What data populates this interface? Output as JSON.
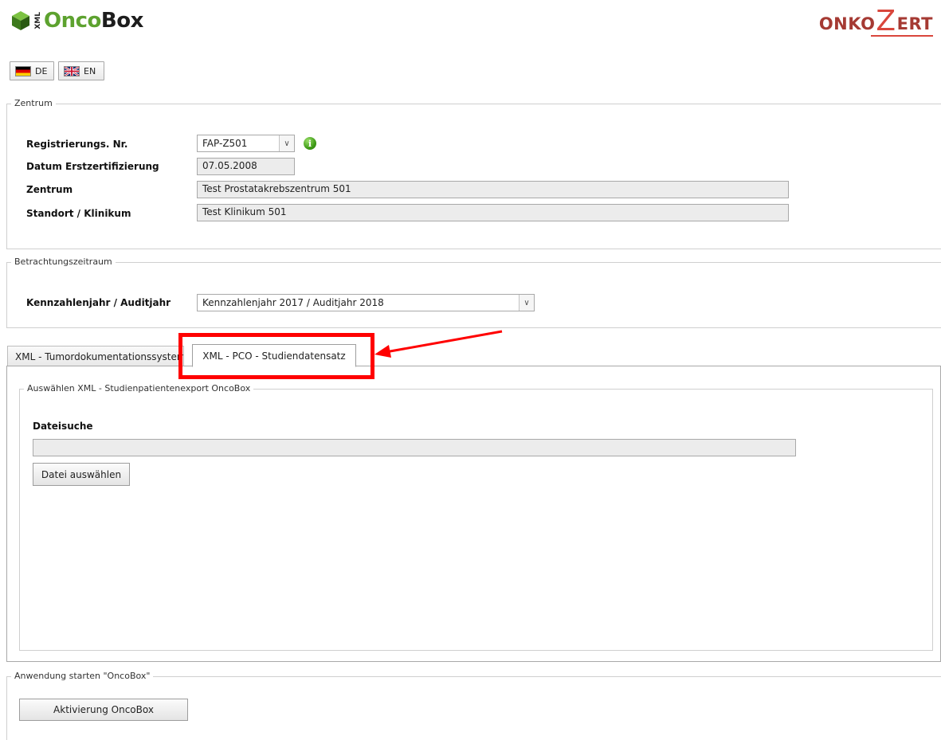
{
  "header": {
    "logo_xml": "XML",
    "logo_onco": "Onco",
    "logo_box": "Box",
    "partner_onko": "ONKO",
    "partner_z": "Z",
    "partner_ert": "ERT"
  },
  "language": {
    "de_label": "DE",
    "en_label": "EN"
  },
  "zentrum": {
    "legend": "Zentrum",
    "reg_label": "Registrierungs. Nr.",
    "reg_value": "FAP-Z501",
    "datum_label": "Datum Erstzertifizierung",
    "datum_value": "07.05.2008",
    "zentrum_label": "Zentrum",
    "zentrum_value": "Test Prostatakrebszentrum 501",
    "standort_label": "Standort / Klinikum",
    "standort_value": "Test Klinikum 501"
  },
  "betrachtung": {
    "legend": "Betrachtungszeitraum",
    "kennzahl_label": "Kennzahlenjahr / Auditjahr",
    "kennzahl_value": "Kennzahlenjahr 2017 / Auditjahr 2018"
  },
  "tabs": [
    {
      "label": "XML - Tumordokumentationssystem",
      "active": false
    },
    {
      "label": "XML - PCO - Studiendatensatz",
      "active": true
    }
  ],
  "panel": {
    "legend": "Auswählen XML - Studienpatientenexport OncoBox",
    "dateisuche_label": "Dateisuche",
    "file_value": "",
    "choose_button": "Datei auswählen"
  },
  "launch": {
    "legend": "Anwendung starten \"OncoBox\"",
    "activate_button": "Aktivierung OncoBox"
  },
  "colors": {
    "onco_green": "#5da22f",
    "onkozert_red": "#d9463c",
    "highlight_red": "#ff0000"
  }
}
